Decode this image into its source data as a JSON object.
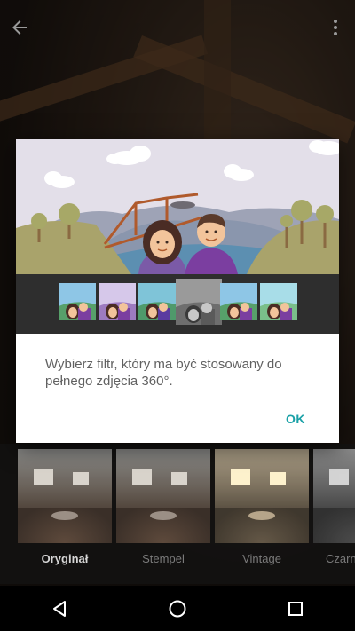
{
  "dialog": {
    "message": "Wybierz filtr, który ma być stosowany do pełnego zdjęcia 360°.",
    "ok_label": "OK",
    "selected_thumb_index": 3
  },
  "filters": [
    {
      "label": "Oryginał",
      "active": true
    },
    {
      "label": "Stempel",
      "active": false
    },
    {
      "label": "Vintage",
      "active": false
    },
    {
      "label": "Czarn",
      "active": false
    }
  ],
  "icons": {
    "back": "arrow-back-icon",
    "more": "more-vert-icon",
    "nav_back": "triangle-back-icon",
    "nav_home": "circle-home-icon",
    "nav_recents": "square-recents-icon"
  },
  "colors": {
    "accent": "#1aa1a7",
    "dialog_bg": "#ffffff",
    "strip_bg": "#2e2e2e",
    "text": "#616161"
  }
}
